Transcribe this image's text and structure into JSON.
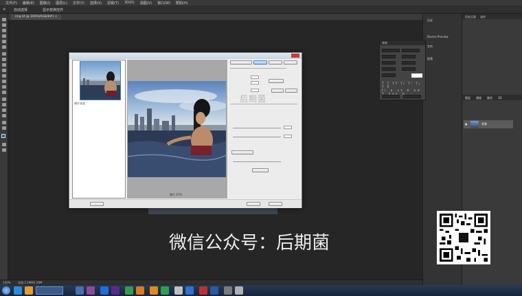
{
  "app": {
    "menu": [
      "文件(F)",
      "编辑(E)",
      "图像(I)",
      "图层(L)",
      "文字(Y)",
      "选择(S)",
      "滤镜(T)",
      "3D(D)",
      "视图(V)",
      "窗口(W)",
      "帮助(H)"
    ],
    "options": [
      "自动选择",
      "显示变换控件"
    ],
    "document_tab": "img.tif @ 100%(RGB/8#) ×"
  },
  "dialog": {
    "watermark": "后期菌",
    "thumb_label": "原片浏览",
    "zoom_label": "原片 67%",
    "buttons": [
      "确定",
      "取消",
      "重置",
      "存储设置"
    ]
  },
  "panels": {
    "dock": [
      "历史",
      "Device Preview",
      "字符",
      "段落"
    ],
    "history_tabs": [
      "历史记录",
      "动作"
    ],
    "layers_tabs": [
      "图层",
      "通道",
      "路径",
      "3D"
    ],
    "layer_name": "背景",
    "char_title": "字符"
  },
  "overlay": {
    "caption": "微信公众号：后期菌"
  },
  "status": {
    "left": "100%",
    "doc": "文档:2.29M/2.29M"
  },
  "colors": {
    "accent": "#3b7fd4",
    "fg": "#1a5fb4",
    "bg": "#4cc8e8"
  }
}
